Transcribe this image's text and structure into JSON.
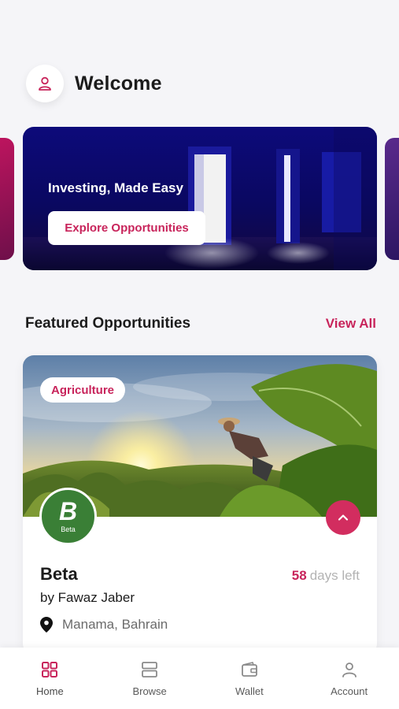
{
  "header": {
    "title": "Welcome",
    "avatar_icon": "user-icon"
  },
  "banner": {
    "title": "Investing, Made Easy",
    "button_label": "Explore Opportunities"
  },
  "featured": {
    "section_title": "Featured Opportunities",
    "view_all_label": "View All",
    "card": {
      "tag": "Agriculture",
      "logo_letter": "B",
      "logo_caption": "Beta",
      "title": "Beta",
      "days_left_number": "58",
      "days_left_text": "days left",
      "byline": "by Fawaz Jaber",
      "location": "Manama, Bahrain"
    }
  },
  "nav": {
    "items": [
      {
        "label": "Home",
        "icon": "home-grid-icon",
        "active": true
      },
      {
        "label": "Browse",
        "icon": "browse-icon",
        "active": false
      },
      {
        "label": "Wallet",
        "icon": "wallet-icon",
        "active": false
      },
      {
        "label": "Account",
        "icon": "account-icon",
        "active": false
      }
    ]
  },
  "colors": {
    "accent": "#c8245b",
    "banner_bg": "#0d0a7a",
    "logo_green": "#3a7f36"
  }
}
